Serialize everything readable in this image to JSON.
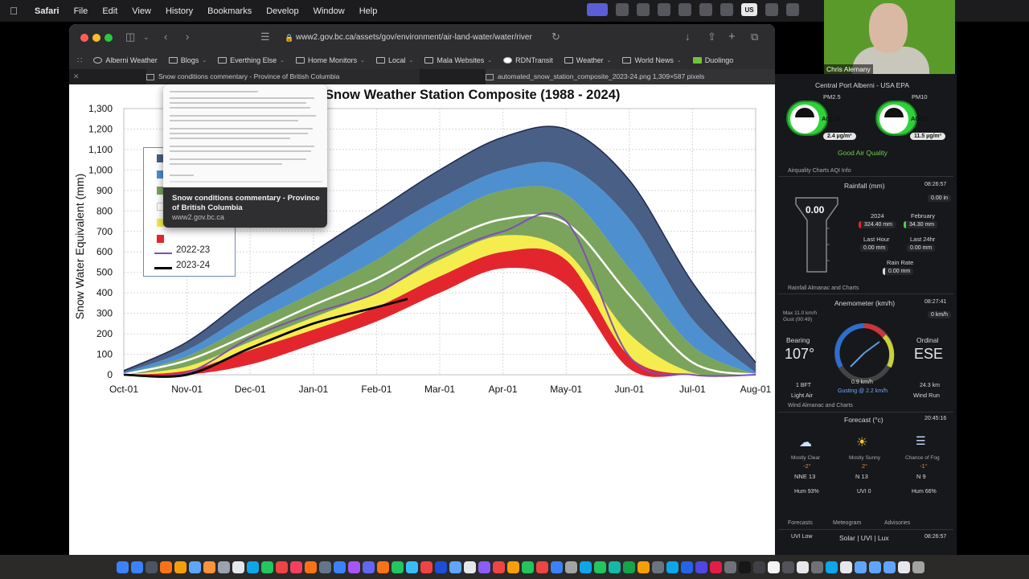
{
  "menubar": {
    "apple": "",
    "items": [
      "Safari",
      "File",
      "Edit",
      "View",
      "History",
      "Bookmarks",
      "Develop",
      "Window",
      "Help"
    ],
    "input_label": "US"
  },
  "browser": {
    "url": "www2.gov.bc.ca/assets/gov/environment/air-land-water/water/river",
    "bookmarks": [
      "Alberni Weather",
      "Blogs",
      "Everthing Else",
      "Home Monitors",
      "Local",
      "Mala Websites",
      "RDNTransit",
      "Weather",
      "World News",
      "Duolingo"
    ],
    "tabs": [
      {
        "label": "Snow conditions commentary - Province of British Columbia"
      },
      {
        "label": "automated_snow_station_composite_2023-24.png 1,309×587 pixels"
      }
    ],
    "tooltip": {
      "title": "Snow conditions commentary - Province of British Columbia",
      "url": "www2.gov.bc.ca"
    }
  },
  "chart_data": {
    "type": "area",
    "title": "Snow Weather Station Composite (1988 - 2024)",
    "ylabel": "Snow Water Equivalent (mm)",
    "xlabel": "",
    "ylim": [
      0,
      1300
    ],
    "yticks": [
      "1,300",
      "1,200",
      "1,100",
      "1,000",
      "900",
      "800",
      "700",
      "600",
      "500",
      "400",
      "300",
      "200",
      "100",
      "0"
    ],
    "categories": [
      "Oct-01",
      "Nov-01",
      "Dec-01",
      "Jan-01",
      "Feb-01",
      "Mar-01",
      "Apr-01",
      "May-01",
      "Jun-01",
      "Jul-01",
      "Aug-01"
    ],
    "grid": true,
    "legend_placement": "top-left",
    "legend_visible": [
      "2022-23",
      "2023-24"
    ],
    "colors": {
      "max": "#4a5f86",
      "p90": "#4e8fcf",
      "p75": "#7aa35c",
      "p50": "#ffffff",
      "p25": "#f5ed4d",
      "p10": "#e3262e",
      "s2022": "#7e4fb6",
      "s2023": "#000000"
    },
    "series": [
      {
        "key": "max",
        "values": [
          20,
          160,
          390,
          600,
          800,
          1000,
          1160,
          1200,
          950,
          450,
          60
        ]
      },
      {
        "key": "p90",
        "values": [
          10,
          120,
          310,
          490,
          680,
          860,
          1000,
          1020,
          760,
          270,
          10
        ]
      },
      {
        "key": "p75",
        "values": [
          5,
          90,
          250,
          400,
          560,
          760,
          900,
          880,
          520,
          140,
          0
        ]
      },
      {
        "key": "p50",
        "values": [
          2,
          70,
          200,
          340,
          470,
          640,
          760,
          740,
          390,
          60,
          0
        ]
      },
      {
        "key": "p25",
        "values": [
          0,
          40,
          160,
          280,
          400,
          560,
          680,
          600,
          200,
          10,
          0
        ]
      },
      {
        "key": "p10",
        "values": [
          0,
          20,
          120,
          220,
          330,
          480,
          600,
          560,
          90,
          0,
          0
        ]
      },
      {
        "key": "lower",
        "values": [
          0,
          0,
          50,
          150,
          260,
          400,
          520,
          440,
          30,
          0,
          0
        ]
      },
      {
        "name": "2022-23",
        "key": "s2022",
        "values": [
          0,
          10,
          180,
          300,
          400,
          580,
          700,
          750,
          90,
          0,
          0
        ]
      },
      {
        "name": "2023-24",
        "key": "s2023",
        "values": [
          0,
          0,
          130,
          250,
          330,
          370
        ]
      }
    ]
  },
  "rightpanel": {
    "station": "Central Port Alberni - USA EPA",
    "pm25_label": "PM2.5",
    "pm10_label": "PM10",
    "pm25_aqi": "AQI 10",
    "pm10_aqi": "AQI 11",
    "pm25_val": "2.4 µg/m³",
    "pm10_val": "11.5 µg/m³",
    "air_quality": "Good Air Quality",
    "airq_links": "Airquality Charts   AQI Info",
    "rain_title": "Rainfall (mm)",
    "rain_time": "08:26:57",
    "rain_now": "0.00",
    "rain_small": "0.00 in",
    "rain_year_lbl": "2024",
    "rain_year": "324.40 mm",
    "rain_month_lbl": "February",
    "rain_month": "34.30 mm",
    "rain_lasthour_lbl": "Last Hour",
    "rain_lasthour": "0.00 mm",
    "rain_last24_lbl": "Last 24hr",
    "rain_last24": "0.00 mm",
    "rain_rate_lbl": "Rain Rate",
    "rain_rate": "0.00 mm",
    "rain_links": "Rainfall Almanac and Charts",
    "wind_title": "Anemometer (km/h)",
    "wind_time": "08:27:41",
    "wind_max": "Max 11.0 km/h",
    "wind_gust": "Gust (00:49)",
    "wind_kmh": "0 km/h",
    "bearing_lbl": "Bearing",
    "bearing": "107°",
    "ordinal_lbl": "Ordinal",
    "ordinal": "ESE",
    "wind_speed": "0.9 km/h",
    "wind_gusting": "Gusting @ 2.2 km/h",
    "wind_bft": "1 BFT",
    "wind_light": "Light Air",
    "wind_run": "24.3 km",
    "wind_run_lbl": "Wind Run",
    "wind_links": "Wind Almanac and Charts",
    "fc_title": "Forecast (°c)",
    "fc_time": "20:45:16",
    "fc": [
      {
        "desc": "Mostly Clear",
        "temp": "-2°",
        "wind": "NNE 13",
        "extra": "Hum 93%"
      },
      {
        "desc": "Mostly Sunny",
        "temp": "2°",
        "wind": "N 13",
        "extra": "UVI 0"
      },
      {
        "desc": "Chance of Fog",
        "temp": "-1°",
        "wind": "N 9",
        "extra": "Hum 66%"
      }
    ],
    "fc_links": [
      "Forecasts",
      "Meteogram",
      "Advisories"
    ],
    "solar_title": "Solar | UVI | Lux",
    "solar_uvi": "UVI Low",
    "solar_time": "08:26:57"
  },
  "webcam": {
    "name": "Chris Alemany"
  }
}
